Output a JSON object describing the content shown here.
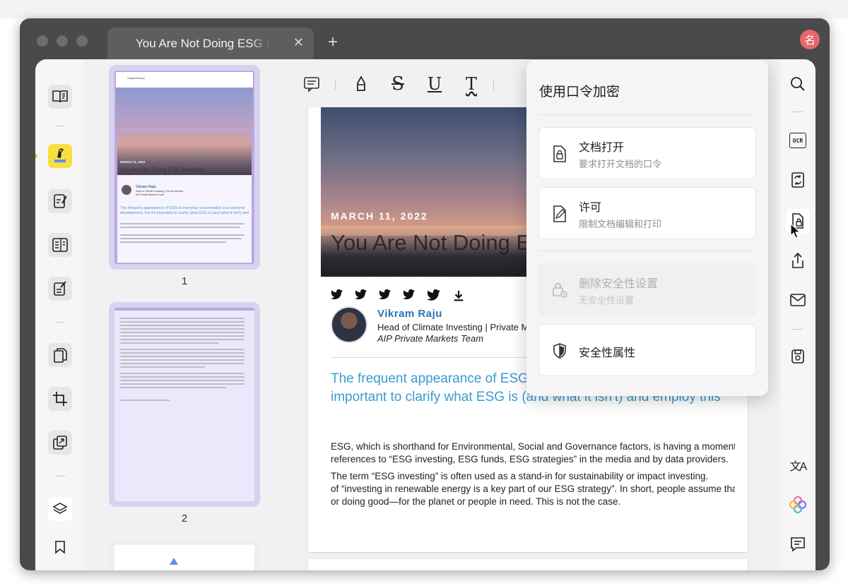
{
  "window": {
    "tab_title": "You Are Not Doing ESG Investing",
    "tab_close_glyph": "✕",
    "new_tab_glyph": "+",
    "user_avatar_text": "名"
  },
  "left_toolbar": {
    "icons": [
      "reader-icon",
      "comment-highlighter-icon",
      "edit-pdf-icon",
      "page-layout-icon",
      "form-icon",
      "organize-pages-icon",
      "crop-icon",
      "convert-icon",
      "layers-icon",
      "bookmark-icon"
    ],
    "active": "comment-highlighter-icon"
  },
  "thumbnails": {
    "page1_label": "1",
    "page2_label": "2",
    "page1": {
      "brand": "VirtpectVentry",
      "date": "MARCH 11, 2022",
      "title": "You Are Not Doing ESG Investing",
      "author": "Vikram Raju",
      "role": "Head of Climate Investing | Private Markets",
      "team": "AIP Private Markets Team",
      "lead": "The frequent appearance of ESG in everyday conversation is a welcome development, but it's important to clarify what ESG is (and what it isn't) and employ this"
    }
  },
  "annotation_toolbar": {
    "icons": [
      "comment-icon",
      "highlighter-icon",
      "strikethrough-icon",
      "underline-icon",
      "squiggly-icon",
      "text-icon"
    ],
    "glyphs": {
      "strike": "S",
      "underline": "U",
      "squiggly": "T",
      "text": "T"
    }
  },
  "document": {
    "date": "MARCH 11, 2022",
    "title": "You Are Not Doing ESG Investing",
    "author": "Vikram Raju",
    "role": "Head of Climate Investing | Private Markets",
    "team": "AIP Private Markets Team",
    "lead_line1": "The frequent appearance of ESG in everyday conversation is a welcome development, but it's",
    "lead_line2": "important to clarify what ESG is (and what it isn't) and employ this",
    "para1_line1": "ESG, which is shorthand for Environmental, Social and Governance factors, is having a moment. There are endless",
    "para1_line2": "references to “ESG investing, ESG funds, ESG strategies” in the media and by data providers.",
    "para2_line1": "The term “ESG investing” is often used as a stand-in for sustainability or impact investing.",
    "para2_line2": "of “investing in renewable energy is a key part of our ESG strategy”. In short, people assume that ESG means investing",
    "para2_line3": "or doing good—for the planet or people in need. This is not the case."
  },
  "security_popover": {
    "title": "使用口令加密",
    "items": [
      {
        "label": "文档打开",
        "sublabel": "要求打开文档的口令",
        "icon": "lock-document-icon",
        "enabled": true
      },
      {
        "label": "许可",
        "sublabel": "限制文档编辑和打印",
        "icon": "edit-document-icon",
        "enabled": true
      },
      {
        "label": "删除安全性设置",
        "sublabel": "无安全性设置",
        "icon": "remove-security-icon",
        "enabled": false
      },
      {
        "label": "安全性属性",
        "icon": "shield-icon",
        "enabled": true
      }
    ]
  },
  "right_toolbar": {
    "icons": [
      "search-icon",
      "ocr-icon",
      "convert-icon",
      "protect-document-icon",
      "share-icon",
      "email-icon",
      "save-icon",
      "translate-icon",
      "ai-assistant-icon",
      "comments-list-icon"
    ],
    "ocr_label": "OCR",
    "translate_glyph": "文A"
  },
  "colors": {
    "highlight_active": "#f8df3f",
    "thumb_selected": "#d8d2ee",
    "link_blue": "#3a9bd0",
    "author_blue": "#2a73b8"
  }
}
